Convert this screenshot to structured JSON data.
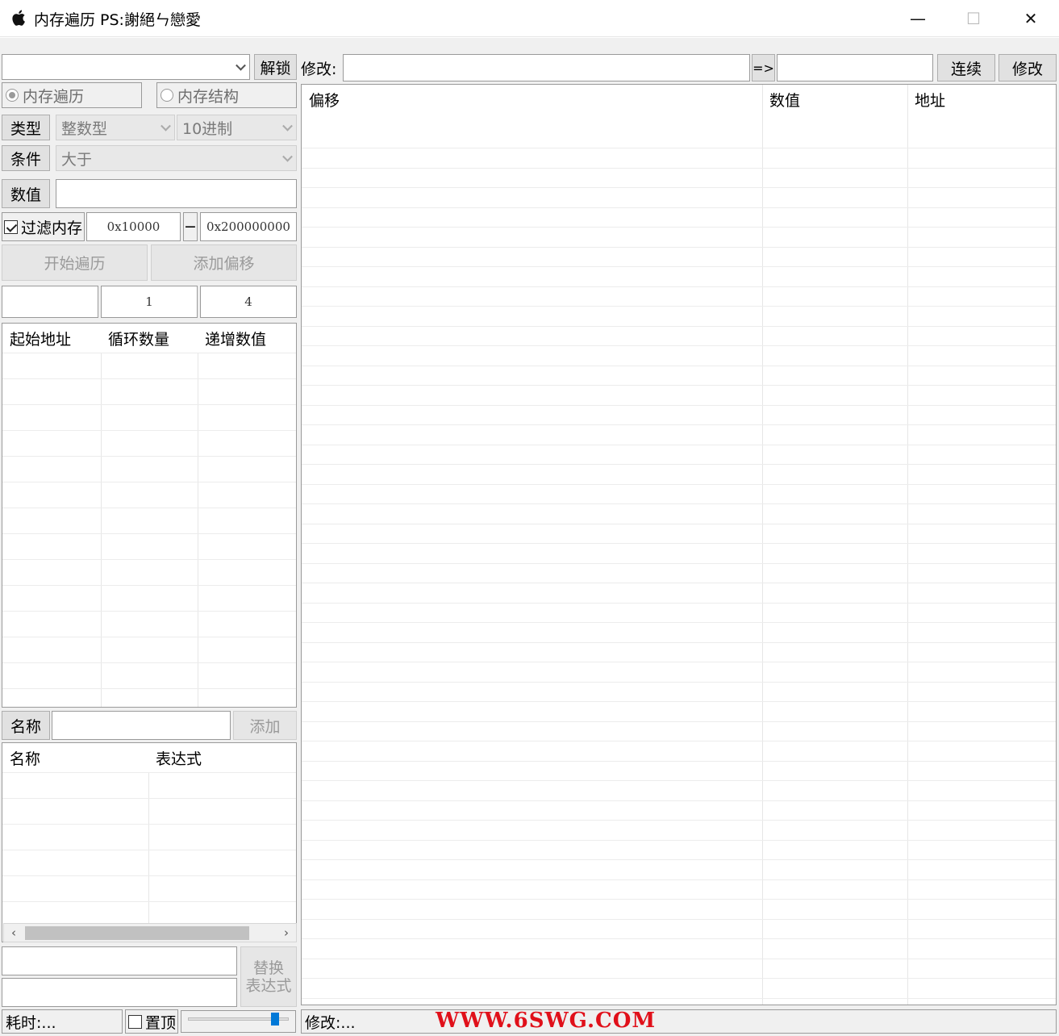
{
  "window": {
    "title": "内存遍历 PS:謝絕ㄣ戀愛",
    "icon": "apple-icon",
    "controls": {
      "minimize": "—",
      "maximize": "☐",
      "close": "✕"
    }
  },
  "left": {
    "process_combo": {
      "value": ""
    },
    "unlock_label": "解锁",
    "mode_radio": {
      "traverse": "内存遍历",
      "structure": "内存结构",
      "selected": "traverse"
    },
    "type_label": "类型",
    "type_value": "整数型",
    "radix_value": "10进制",
    "cond_label": "条件",
    "cond_value": "大于",
    "value_label": "数值",
    "value_input": "",
    "filter": {
      "label": "过滤内存",
      "checked": true,
      "start": "0x10000",
      "dash": "−",
      "end": "0x200000000"
    },
    "start_button": "开始遍历",
    "add_offset_button": "添加偏移",
    "offset_inputs": [
      "",
      "1",
      "4"
    ],
    "loop_table": {
      "headers": [
        "起始地址",
        "循环数量",
        "递增数值"
      ],
      "rows": []
    },
    "name_label": "名称",
    "name_input": "",
    "add_button": "添加",
    "expr_table": {
      "headers": [
        "名称",
        "表达式"
      ],
      "rows": []
    },
    "replace_inputs": [
      "",
      ""
    ],
    "replace_button": "替换\n表达式",
    "status_time": "耗时:...",
    "topmost": {
      "label": "置顶",
      "checked": false
    },
    "slider_level": 0.88
  },
  "right": {
    "modify_label": "修改:",
    "modify_input": "",
    "arrow_button": "=>",
    "target_input": "",
    "continuous_button": "连续",
    "modify_button": "修改",
    "result_table": {
      "headers": [
        "偏移",
        "数值",
        "地址"
      ],
      "rows": []
    },
    "status_modify": "修改:..."
  },
  "watermark_text": "WWW.6SWG.COM",
  "colors": {
    "accent": "#0078d7",
    "watermark": "#e0101a"
  }
}
